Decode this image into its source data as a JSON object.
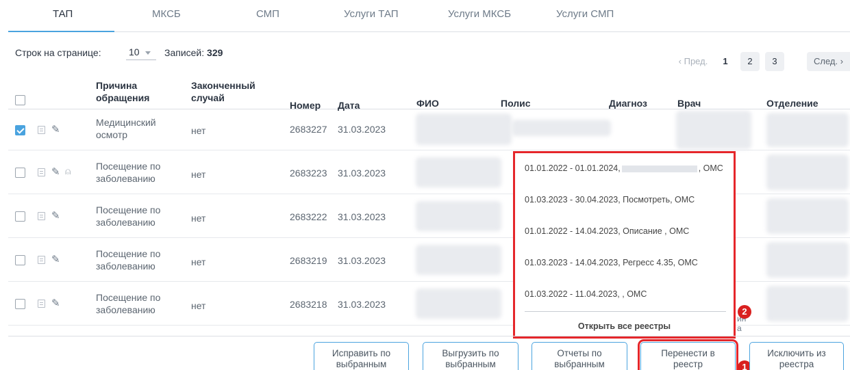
{
  "tabs": [
    "ТАП",
    "МКСБ",
    "СМП",
    "Услуги ТАП",
    "Услуги МКСБ",
    "Услуги СМП"
  ],
  "pagination": {
    "rows_label": "Строк на странице:",
    "rows_value": "10",
    "records_label": "Записей:",
    "records_value": "329",
    "prev": "Пред.",
    "pages": [
      "1",
      "2",
      "3"
    ],
    "next": "След."
  },
  "table": {
    "headers": {
      "reason": "Причина\nобращения",
      "reason_l1": "Причина",
      "reason_l2": "обращения",
      "done_l1": "Законченный",
      "done_l2": "случай",
      "number": "Номер",
      "date": "Дата",
      "fio": "ФИО",
      "policy": "Полис",
      "diagnosis": "Диагноз",
      "doctor": "Врач",
      "department": "Отделение"
    },
    "rows": [
      {
        "checked": true,
        "reason_l1": "Медицинский",
        "reason_l2": "осмотр",
        "done": "нет",
        "number": "2683227",
        "date": "31.03.2023"
      },
      {
        "checked": false,
        "reason_l1": "Посещение по",
        "reason_l2": "заболеванию",
        "done": "нет",
        "number": "2683223",
        "date": "31.03.2023"
      },
      {
        "checked": false,
        "reason_l1": "Посещение по",
        "reason_l2": "заболеванию",
        "done": "нет",
        "number": "2683222",
        "date": "31.03.2023"
      },
      {
        "checked": false,
        "reason_l1": "Посещение по",
        "reason_l2": "заболеванию",
        "done": "нет",
        "number": "2683219",
        "date": "31.03.2023"
      },
      {
        "checked": false,
        "reason_l1": "Посещение по",
        "reason_l2": "заболеванию",
        "done": "нет",
        "number": "2683218",
        "date": "31.03.2023"
      }
    ]
  },
  "dropdown": {
    "items": [
      {
        "pre": "01.01.2022 - 01.01.2024,",
        "post": ", ОМС"
      },
      {
        "pre": "01.03.2023 - 30.04.2023, Посмотреть, ОМС",
        "post": ""
      },
      {
        "pre": "01.01.2022 - 14.04.2023, Описание , ОМС",
        "post": ""
      },
      {
        "pre": "01.03.2023 - 14.04.2023, Регресс 4.35, ОМС",
        "post": ""
      },
      {
        "pre": "01.03.2022 - 11.04.2023, , ОМС",
        "post": ""
      }
    ],
    "open_all": "Открыть все реестры"
  },
  "buttons": {
    "fix_l1": "Исправить по",
    "fix_l2": "выбранным",
    "export_l1": "Выгрузить по",
    "export_l2": "выбранным",
    "reports_l1": "Отчеты по",
    "reports_l2": "выбранным",
    "transfer_l1": "Перенести в",
    "transfer_l2": "реестр",
    "exclude_l1": "Исключить из",
    "exclude_l2": "реестра"
  },
  "annotations": {
    "badge1": "1",
    "badge2": "2"
  },
  "colors": {
    "accent": "#4aa3df",
    "highlight": "#e5262a",
    "badge": "#d9201f"
  },
  "peek_text": {
    "l1": "ин",
    "l2": "а"
  }
}
